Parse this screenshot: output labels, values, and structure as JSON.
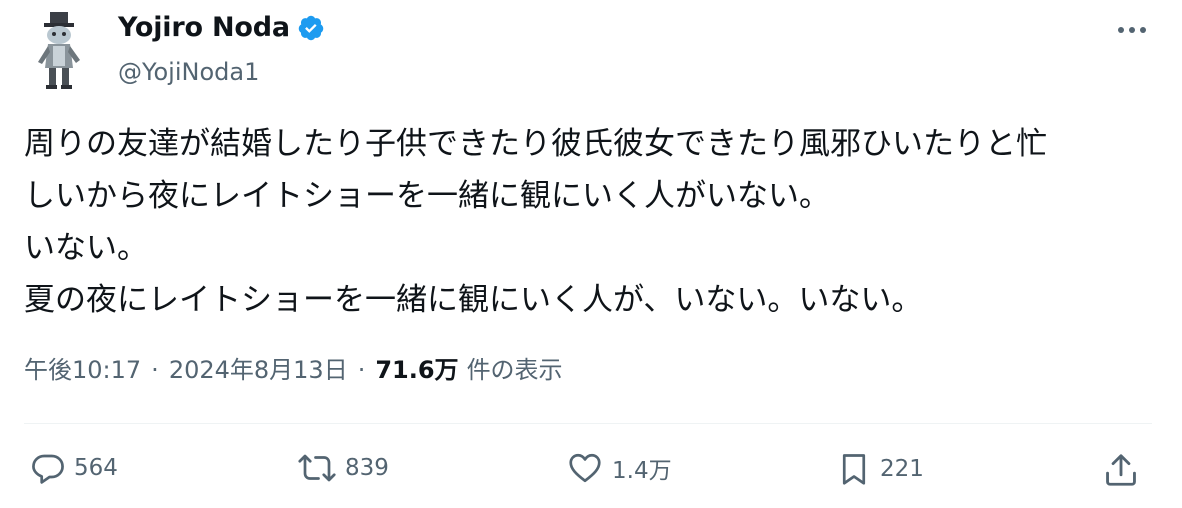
{
  "author": {
    "name": "Yojiro Noda",
    "handle": "@YojiNoda1",
    "verified": true,
    "avatar_icon": "character-avatar-icon"
  },
  "tweet": {
    "lines": [
      "周りの友達が結婚したり子供できたり彼氏彼女できたり風邪ひいたりと忙",
      "しいから夜にレイトショーを一緒に観にいく人がいない。",
      "いない。",
      "夏の夜にレイトショーを一緒に観にいく人が、いない。いない。"
    ]
  },
  "meta": {
    "time": "午後10:17",
    "separator": "·",
    "date": "2024年8月13日",
    "views_count": "71.6万",
    "views_label": "件の表示"
  },
  "actions": {
    "reply_count": "564",
    "retweet_count": "839",
    "like_count": "1.4万",
    "bookmark_count": "221"
  },
  "colors": {
    "text_primary": "#0f1419",
    "text_secondary": "#536471",
    "verified_blue": "#1d9bf0",
    "divider": "#eff3f4"
  }
}
